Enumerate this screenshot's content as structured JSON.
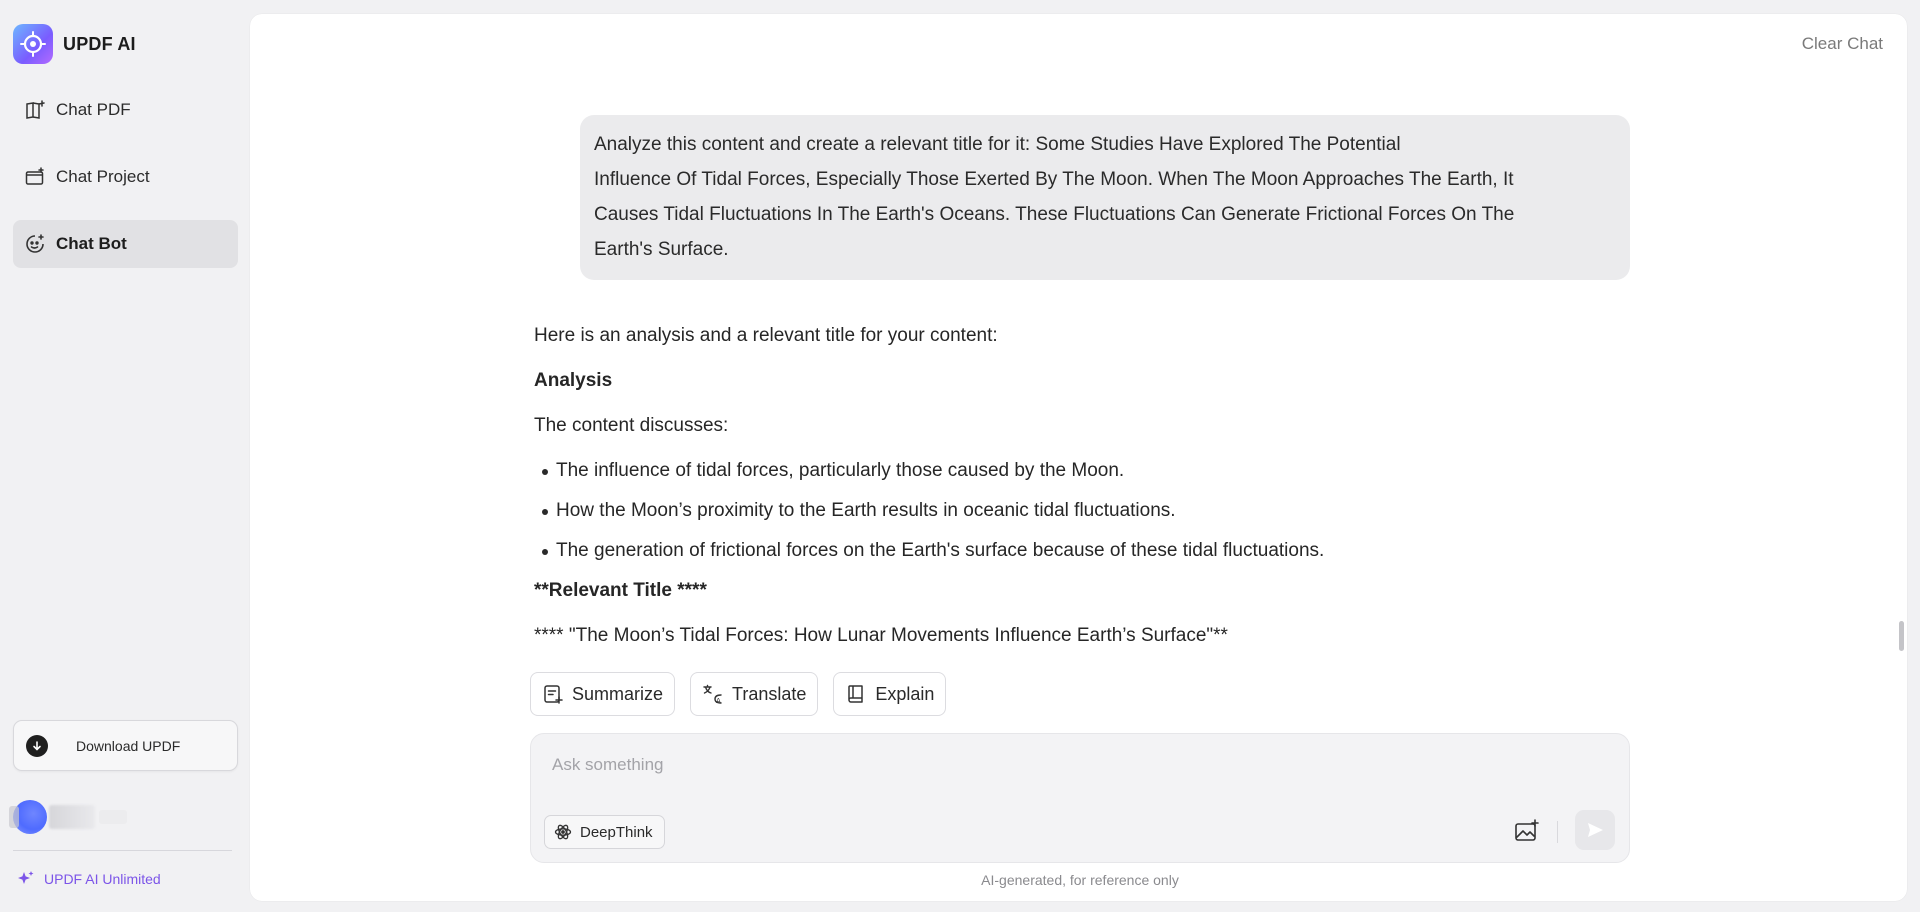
{
  "app": {
    "brand_name": "UPDF AI",
    "accent_color": "#7c55e8"
  },
  "sidebar": {
    "items": [
      {
        "label": "Chat PDF",
        "icon": "book-open-icon",
        "active": false
      },
      {
        "label": "Chat Project",
        "icon": "folder-sparkle-icon",
        "active": false
      },
      {
        "label": "Chat Bot",
        "icon": "bot-face-icon",
        "active": true
      }
    ],
    "download_label": "Download UPDF",
    "unlimited_label": "UPDF AI Unlimited"
  },
  "header": {
    "clear_chat_label": "Clear Chat"
  },
  "conversation": {
    "user_message_lines": [
      "Analyze this content and create a relevant title for it: Some Studies Have Explored The Potential",
      "Influence Of Tidal Forces, Especially Those Exerted By The Moon. When The Moon Approaches The Earth, It",
      "Causes Tidal Fluctuations In The Earth's Oceans. These Fluctuations Can Generate Frictional Forces On The",
      "Earth's Surface."
    ],
    "answer": {
      "intro": "Here is an analysis and a relevant title for your content:",
      "analysis_heading": "Analysis",
      "discusses_label": "The content discusses:",
      "bullets": [
        "The influence of tidal forces, particularly those caused by the Moon.",
        "How the Moon’s proximity to the Earth results in oceanic tidal fluctuations.",
        "The generation of frictional forces on the Earth's surface because of these tidal fluctuations."
      ],
      "title_heading": "**Relevant Title ****",
      "title_line": "**** \"The Moon’s Tidal Forces: How Lunar Movements Influence Earth’s Surface\"**"
    },
    "actions": [
      {
        "label": "Summarize",
        "icon": "summarize-icon"
      },
      {
        "label": "Translate",
        "icon": "translate-icon"
      },
      {
        "label": "Explain",
        "icon": "book-icon"
      }
    ]
  },
  "composer": {
    "placeholder": "Ask something",
    "value": "",
    "deepthink_label": "DeepThink",
    "disclaimer": "AI-generated, for reference only"
  }
}
